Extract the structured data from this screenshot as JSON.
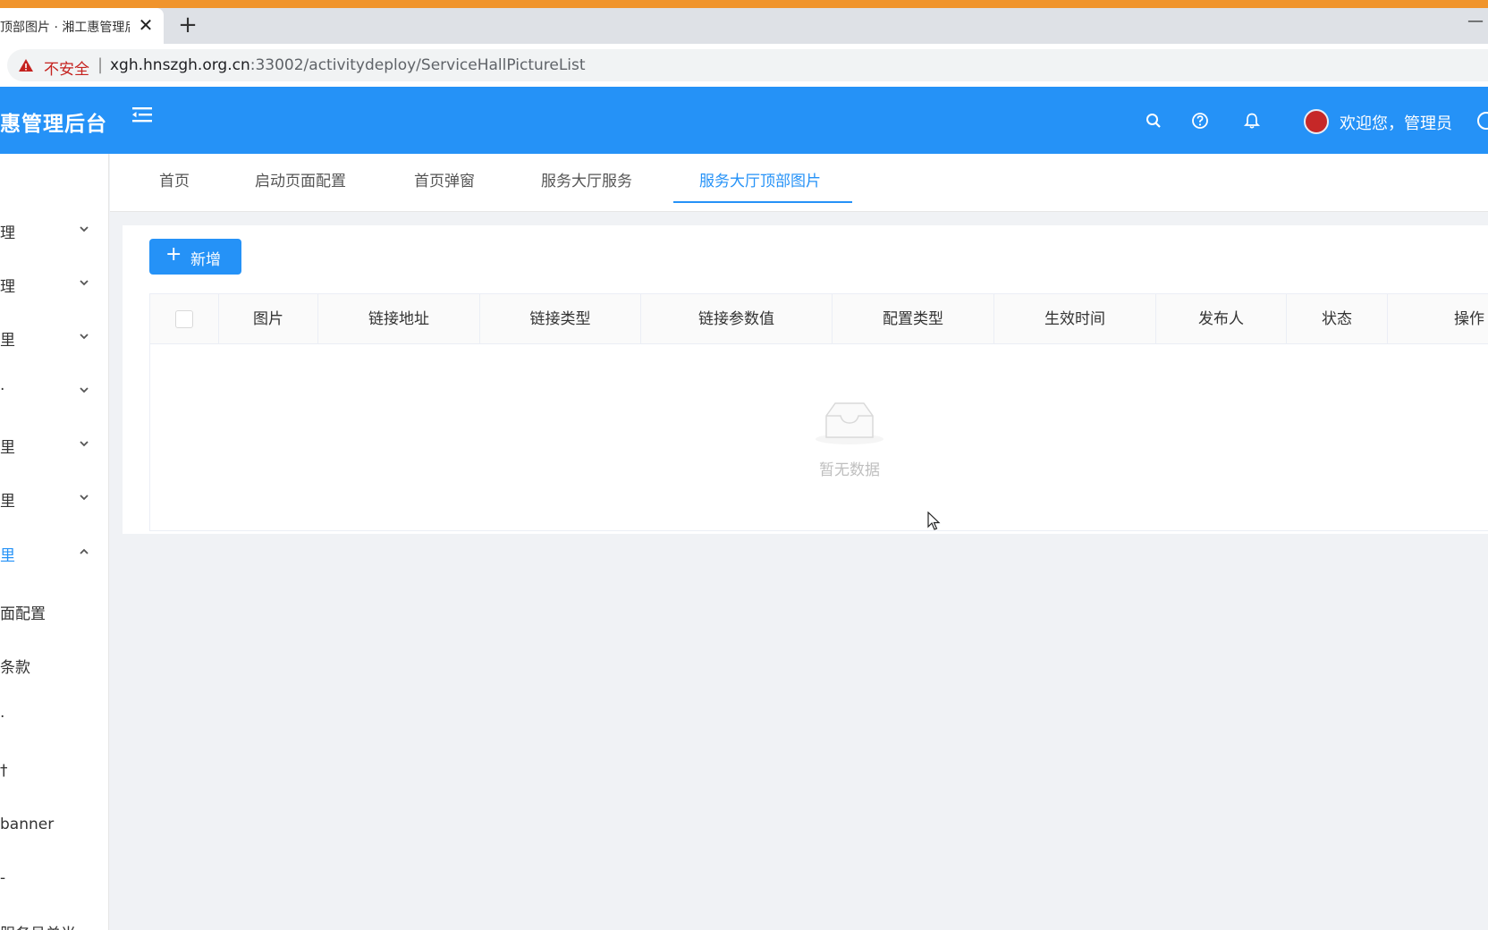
{
  "browser": {
    "tab_title": "顶部图片 · 湘工惠管理后",
    "close_glyph": "✕",
    "new_tab_glyph": "+",
    "minimize_glyph": "—",
    "security_label": "不安全",
    "separator": "|",
    "url_host": "xgh.hnszgh.org.cn",
    "url_rest": ":33002/activitydeploy/ServiceHallPictureList"
  },
  "header": {
    "app_title": "惠管理后台",
    "welcome": "欢迎您，管理员",
    "bg_color": "#2592f7"
  },
  "sidebar": {
    "groups": [
      {
        "label": "理",
        "expanded": false
      },
      {
        "label": "理",
        "expanded": false
      },
      {
        "label": "里",
        "expanded": false
      },
      {
        "label": "·",
        "expanded": false
      },
      {
        "label": "里",
        "expanded": false
      },
      {
        "label": "里",
        "expanded": false
      },
      {
        "label": "里",
        "expanded": true
      }
    ],
    "sub_items": [
      {
        "label": "面配置"
      },
      {
        "label": "条款"
      },
      {
        "label": "·"
      },
      {
        "label": "†"
      },
      {
        "label": "banner"
      },
      {
        "label": "-"
      },
      {
        "label": "服务号单当"
      }
    ]
  },
  "tabs": [
    {
      "label": "首页",
      "active": false
    },
    {
      "label": "启动页面配置",
      "active": false
    },
    {
      "label": "首页弹窗",
      "active": false
    },
    {
      "label": "服务大厅服务",
      "active": false
    },
    {
      "label": "服务大厅顶部图片",
      "active": true
    }
  ],
  "toolbar": {
    "add_plus": "+",
    "add_label": "新增"
  },
  "table": {
    "columns": [
      "图片",
      "链接地址",
      "链接类型",
      "链接参数值",
      "配置类型",
      "生效时间",
      "发布人",
      "状态",
      "操作"
    ],
    "rows": [],
    "empty_text": "暂无数据"
  }
}
